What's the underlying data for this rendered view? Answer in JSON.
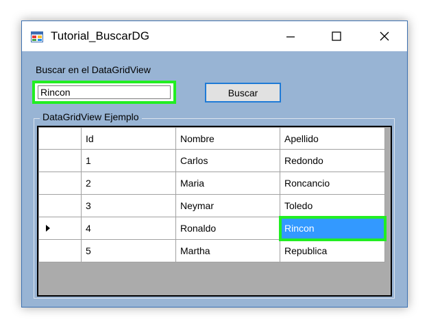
{
  "window": {
    "title": "Tutorial_BuscarDG"
  },
  "search": {
    "label": "Buscar en el DataGridView",
    "value": "Rincon",
    "button_label": "Buscar"
  },
  "groupbox": {
    "label": "DataGridView Ejemplo"
  },
  "grid": {
    "columns": [
      "Id",
      "Nombre",
      "Apellido"
    ],
    "rows": [
      {
        "id": "1",
        "nombre": "Carlos",
        "apellido": "Redondo"
      },
      {
        "id": "2",
        "nombre": "Maria",
        "apellido": "Roncancio"
      },
      {
        "id": "3",
        "nombre": "Neymar",
        "apellido": "Toledo"
      },
      {
        "id": "4",
        "nombre": "Ronaldo",
        "apellido": "Rincon"
      },
      {
        "id": "5",
        "nombre": "Martha",
        "apellido": "Republica"
      }
    ],
    "current_row": 3,
    "selected_cell": "Apellido",
    "selection_color": "#3399ff",
    "highlight_color": "#22ee22"
  },
  "icons": {
    "app": "app-form-icon",
    "minimize": "minimize-icon",
    "maximize": "maximize-icon",
    "close": "close-icon",
    "row_indicator": "current-row-arrow-icon"
  }
}
